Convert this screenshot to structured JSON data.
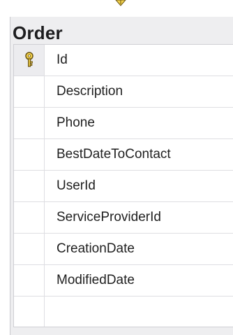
{
  "table": {
    "title": "Order",
    "columns": [
      {
        "name": "Id",
        "primary_key": true
      },
      {
        "name": "Description",
        "primary_key": false
      },
      {
        "name": "Phone",
        "primary_key": false
      },
      {
        "name": "BestDateToContact",
        "primary_key": false
      },
      {
        "name": "UserId",
        "primary_key": false
      },
      {
        "name": "ServiceProviderId",
        "primary_key": false
      },
      {
        "name": "CreationDate",
        "primary_key": false
      },
      {
        "name": "ModifiedDate",
        "primary_key": false
      }
    ]
  },
  "icons": {
    "primary_key": "key-icon",
    "relationship_end": "connector-arrow-icon"
  },
  "colors": {
    "key_fill": "#f2d14a",
    "key_stroke": "#6b5514",
    "connector": "#e6c52f"
  }
}
